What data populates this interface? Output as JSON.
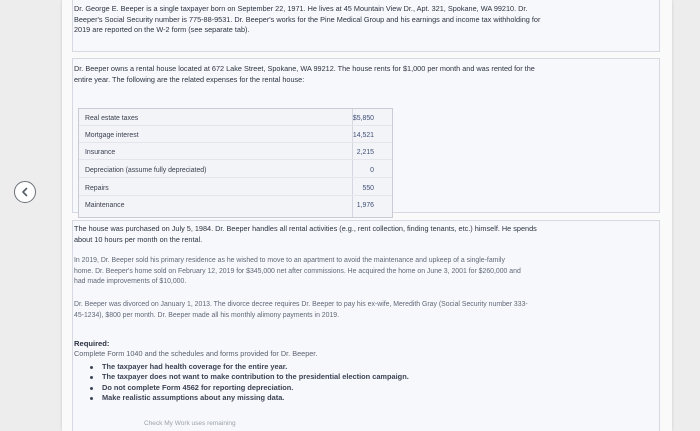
{
  "intro": {
    "line1": "Dr. George E. Beeper is a single taxpayer born on September 22, 1971. He lives at 45 Mountain View Dr., Apt. 321, Spokane, WA 99210. Dr.",
    "line2": "Beeper's Social Security number is 775-88-9531. Dr. Beeper's works for the Pine Medical Group and his earnings and income tax withholding for",
    "line3": "2019 are reported on the W-2 form (see separate tab)."
  },
  "rental_intro": {
    "line1": "Dr. Beeper owns a rental house located at 672 Lake Street, Spokane, WA 99212. The house rents for $1,000 per month and was rented for the",
    "line2": "entire year. The following are the related expenses for the rental house:"
  },
  "expenses": [
    {
      "label": "Real estate taxes",
      "value": "$5,850"
    },
    {
      "label": "Mortgage interest",
      "value": "14,521"
    },
    {
      "label": "Insurance",
      "value": "2,215"
    },
    {
      "label": "Depreciation (assume fully depreciated)",
      "value": "0"
    },
    {
      "label": "Repairs",
      "value": "550"
    },
    {
      "label": "Maintenance",
      "value": "1,976"
    }
  ],
  "purchase": {
    "line1": "The house was purchased on July 5, 1984. Dr. Beeper handles all rental activities (e.g., rent collection, finding tenants, etc.) himself. He spends",
    "line2": "about 10 hours per month on the rental."
  },
  "sale": {
    "line1": "In 2019, Dr. Beeper sold his primary residence as he wished to move to an apartment to avoid the maintenance and upkeep of a single-family",
    "line2": "home. Dr. Beeper's home sold on February 12, 2019 for $345,000 net after commissions. He acquired the home on June 3, 2001 for $260,000 and",
    "line3": "had made improvements of $10,000."
  },
  "divorce": {
    "line1": "Dr. Beeper was divorced on January 1, 2013. The divorce decree requires Dr. Beeper to pay his ex-wife, Meredith Gray (Social Security number 333-",
    "line2": "45-1234), $800 per month. Dr. Beeper made all his monthly alimony payments in 2019."
  },
  "required": {
    "heading": "Required:",
    "instruction": "Complete Form 1040 and the schedules and forms provided for Dr. Beeper.",
    "bullets": [
      "The taxpayer had health coverage for the entire year.",
      "The taxpayer does not want to make contribution to the presidential election campaign.",
      "Do not complete Form 4562 for reporting depreciation.",
      "Make realistic assumptions about any missing data."
    ]
  },
  "footer": "Check My Work uses remaining"
}
